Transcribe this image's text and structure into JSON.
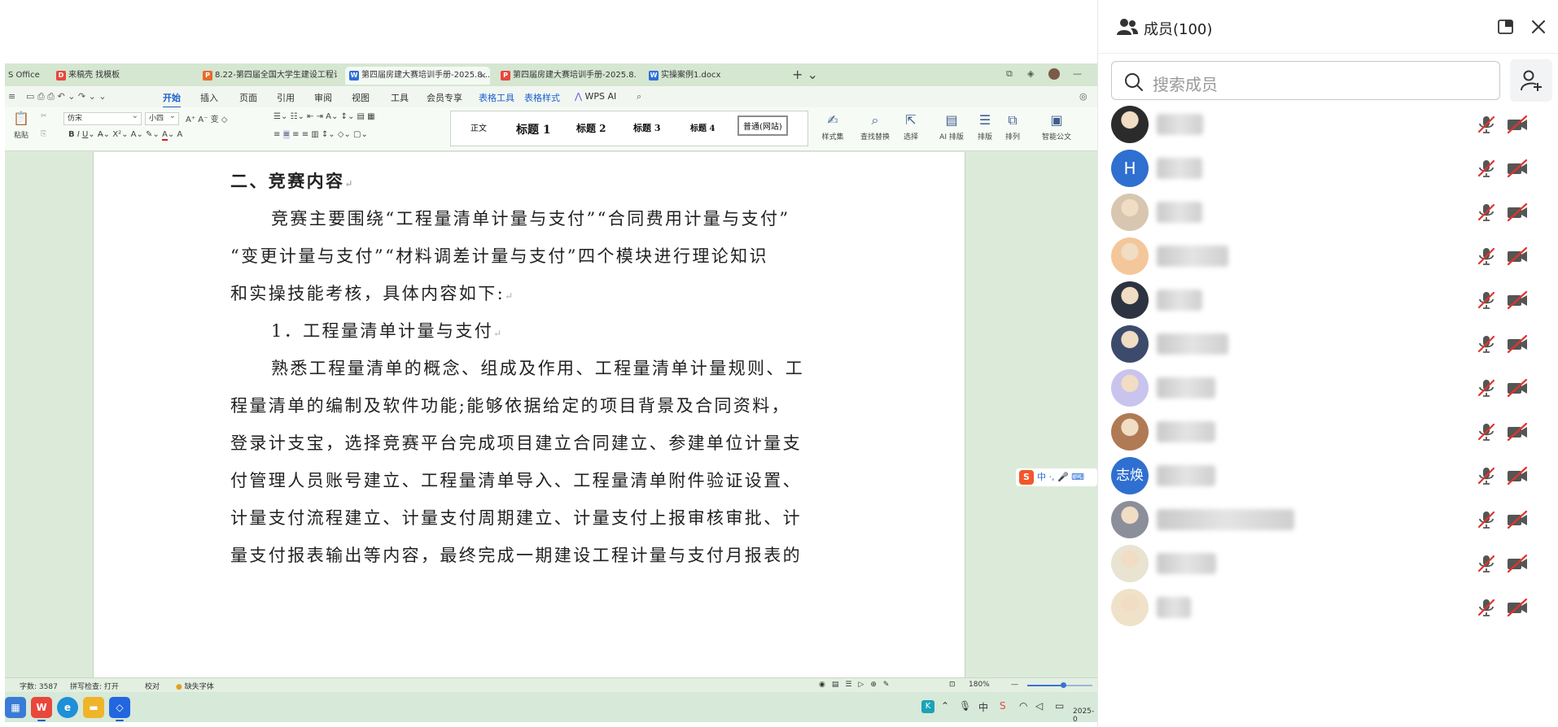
{
  "wps": {
    "tabs": [
      {
        "label": "S Office",
        "icon": "",
        "color": "#d5e6d1"
      },
      {
        "label": "来稿壳 找模板",
        "icon": "D",
        "color": "#e8473c"
      },
      {
        "label": "8.22-第四届全国大学生建设工程计量",
        "icon": "P",
        "color": "#e86b2a"
      },
      {
        "label": "第四届房建大赛培训手册-2025.8...",
        "icon": "W",
        "color": "#2f6ed8"
      },
      {
        "label": "第四届房建大赛培训手册-2025.8.20...",
        "icon": "P",
        "color": "#e8473c"
      },
      {
        "label": "实操案例1.docx",
        "icon": "W",
        "color": "#2f6ed8"
      }
    ],
    "menus": [
      "开始",
      "插入",
      "页面",
      "引用",
      "审阅",
      "视图",
      "工具",
      "会员专享",
      "表格工具",
      "表格样式",
      "WPS AI"
    ],
    "ribbon": {
      "paste": "粘贴",
      "font": "仿宋",
      "size": "小四",
      "styles": [
        "正文",
        "标题 1",
        "标题 2",
        "标题 3",
        "标题 4",
        "普通(网站)"
      ],
      "style_set": "样式集",
      "find_replace": "查找替换",
      "select": "选择",
      "ai_layout": "AI 排版",
      "layout": "排版",
      "arrange": "排列",
      "smart_doc": "智能公文"
    },
    "doc": {
      "heading": "二、竞赛内容",
      "lines": [
        "竞赛主要围绕“工程量清单计量与支付”“合同费用计量与支付”",
        "“变更计量与支付”“材料调差计量与支付”四个模块进行理论知识",
        "和实操技能考核，具体内容如下:",
        "1．工程量清单计量与支付",
        "熟悉工程量清单的概念、组成及作用、工程量清单计量规则、工",
        "程量清单的编制及软件功能;能够依据给定的项目背景及合同资料，",
        "登录计支宝，选择竞赛平台完成项目建立合同建立、参建单位计量支",
        "付管理人员账号建立、工程量清单导入、工程量清单附件验证设置、",
        "计量支付流程建立、计量支付周期建立、计量支付上报审核审批、计",
        "量支付报表输出等内容，最终完成一期建设工程计量与支付月报表的"
      ],
      "pmark": "↵"
    },
    "ime": "中",
    "status": {
      "word_count": "字数: 3587",
      "spell_check": "拼写检查: 打开",
      "proof": "校对",
      "missing_font": "缺失字体",
      "zoom": "180%",
      "zoom_level": 0.55
    },
    "clock": "2025-0"
  },
  "panel": {
    "title": "成员(100)",
    "search_placeholder": "搜索成员",
    "members": [
      {
        "avatar": "photo",
        "initial": "",
        "color": "#2b2b2b",
        "name": "■■晨"
      },
      {
        "avatar": "initial",
        "initial": "H",
        "color": "#2f6fd0",
        "name": "■■■"
      },
      {
        "avatar": "photo",
        "initial": "",
        "color": "#d8c6b0",
        "name": "■■■"
      },
      {
        "avatar": "photo",
        "initial": "",
        "color": "#f3c79a",
        "name": "■■■■■"
      },
      {
        "avatar": "photo",
        "initial": "",
        "color": "#2d3340",
        "name": "■■■"
      },
      {
        "avatar": "photo",
        "initial": "",
        "color": "#3c4b6b",
        "name": "■■■■■"
      },
      {
        "avatar": "photo",
        "initial": "",
        "color": "#c9c4ee",
        "name": "■■■■"
      },
      {
        "avatar": "photo",
        "initial": "",
        "color": "#b07a54",
        "name": "■■■■"
      },
      {
        "avatar": "initial",
        "initial": "志焕",
        "color": "#2f6fd0",
        "name": "■■■■"
      },
      {
        "avatar": "photo",
        "initial": "",
        "color": "#8a8f9a",
        "name": "■■■■■■■■■■"
      },
      {
        "avatar": "photo",
        "initial": "",
        "color": "#e9e3d2",
        "name": "■■■州"
      },
      {
        "avatar": "photo",
        "initial": "",
        "color": "#f0e2c8",
        "name": "飞飞"
      }
    ]
  }
}
